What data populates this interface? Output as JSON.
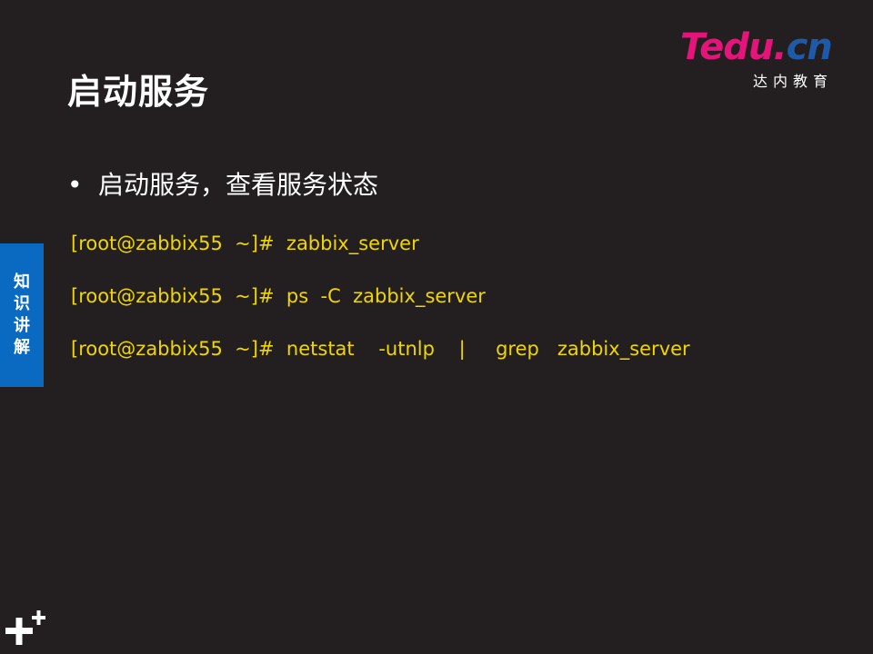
{
  "slide": {
    "title": "启动服务",
    "bullet_marker": "•",
    "bullet_text": "启动服务，查看服务状态",
    "commands": [
      "[root@zabbix55  ~]#  zabbix_server",
      "[root@zabbix55  ~]#  ps  -C  zabbix_server",
      "[root@zabbix55  ~]#  netstat    -utnlp    |     grep   zabbix_server"
    ]
  },
  "logo": {
    "word_main": "Tedu.",
    "word_cn": "cn",
    "subtitle": "达内教育",
    "colors": {
      "main": "#e5147a",
      "cn": "#1e5aa8"
    }
  },
  "side_tab": {
    "chars": [
      "知",
      "识",
      "讲",
      "解"
    ],
    "color": "#0a6ac2"
  },
  "icons": {
    "bottom_left": "plus-plus-icon"
  },
  "colors": {
    "background": "#231f20",
    "command_text": "#f0d600"
  }
}
